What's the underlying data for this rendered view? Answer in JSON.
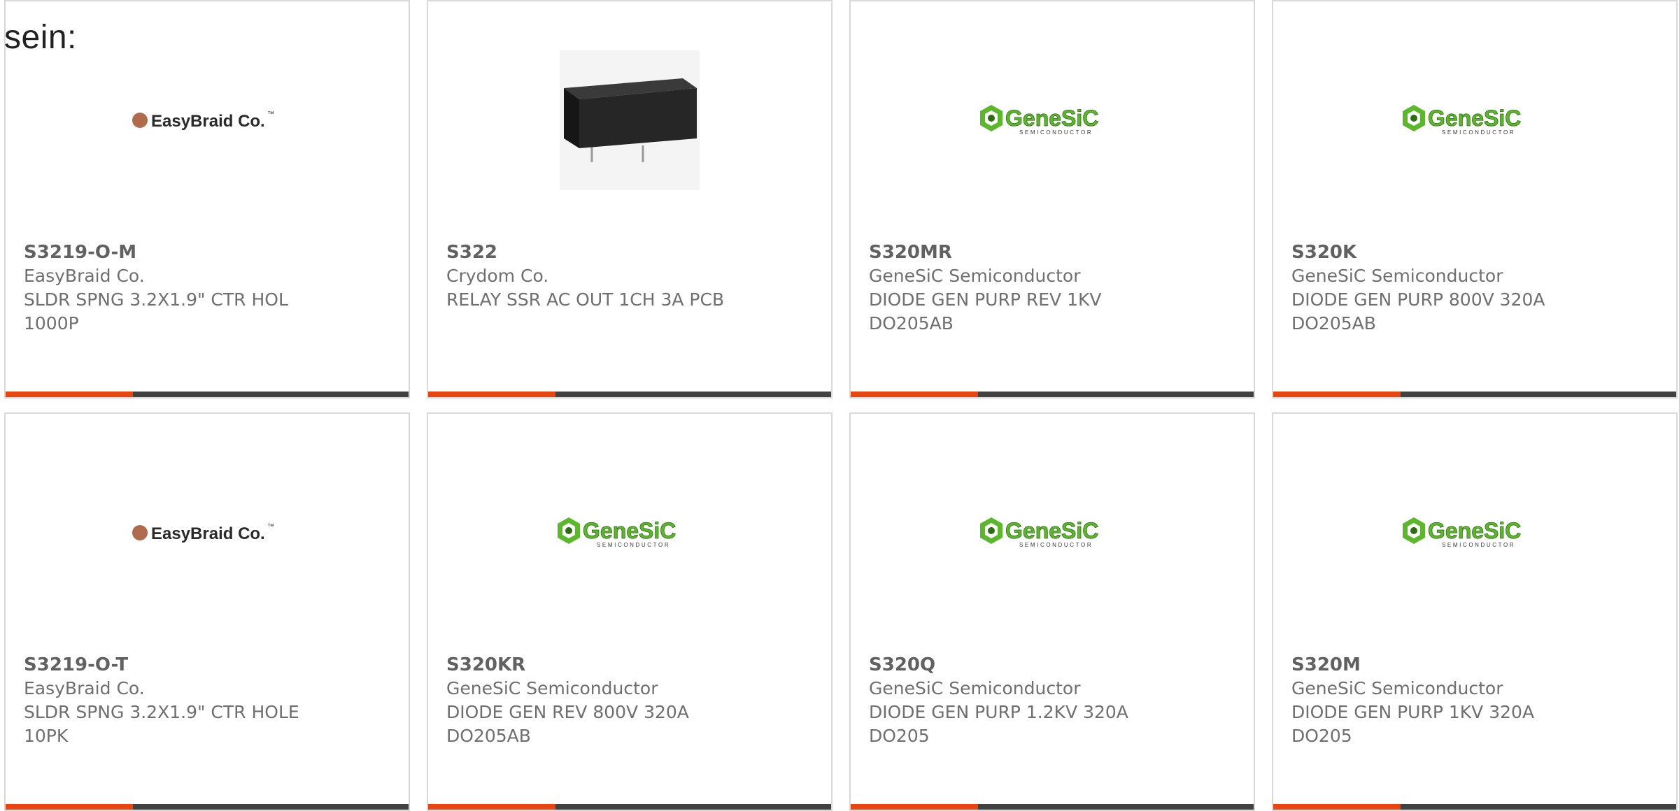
{
  "page": {
    "intro_text": "sein:"
  },
  "colors": {
    "accent": "#e84511",
    "footer": "#414141",
    "border": "#d9d9d9",
    "genesic_green": "#5ab82a",
    "easybraid_brown": "#b06a4c"
  },
  "products": [
    {
      "part_number": "S3219-O-M",
      "manufacturer": "EasyBraid Co.",
      "description": "SLDR SPNG 3.2X1.9\" CTR HOL 1000P",
      "image": {
        "type": "easybraid-logo",
        "text": "EasyBraid Co.",
        "mark": "™"
      }
    },
    {
      "part_number": "S322",
      "manufacturer": "Crydom Co.",
      "description": "RELAY SSR AC OUT 1CH 3A PCB",
      "image": {
        "type": "relay-photo"
      }
    },
    {
      "part_number": "S320MR",
      "manufacturer": "GeneSiC Semiconductor",
      "description": "DIODE GEN PURP REV 1KV DO205AB",
      "image": {
        "type": "genesic-logo",
        "text": "GeneSiC",
        "subtext": "SEMICONDUCTOR"
      }
    },
    {
      "part_number": "S320K",
      "manufacturer": "GeneSiC Semiconductor",
      "description": "DIODE GEN PURP 800V 320A DO205AB",
      "image": {
        "type": "genesic-logo",
        "text": "GeneSiC",
        "subtext": "SEMICONDUCTOR"
      }
    },
    {
      "part_number": "S3219-O-T",
      "manufacturer": "EasyBraid Co.",
      "description": "SLDR SPNG 3.2X1.9\" CTR HOLE 10PK",
      "image": {
        "type": "easybraid-logo",
        "text": "EasyBraid Co.",
        "mark": "™"
      }
    },
    {
      "part_number": "S320KR",
      "manufacturer": "GeneSiC Semiconductor",
      "description": "DIODE GEN REV 800V 320A DO205AB",
      "image": {
        "type": "genesic-logo",
        "text": "GeneSiC",
        "subtext": "SEMICONDUCTOR"
      }
    },
    {
      "part_number": "S320Q",
      "manufacturer": "GeneSiC Semiconductor",
      "description": "DIODE GEN PURP 1.2KV 320A DO205",
      "image": {
        "type": "genesic-logo",
        "text": "GeneSiC",
        "subtext": "SEMICONDUCTOR"
      }
    },
    {
      "part_number": "S320M",
      "manufacturer": "GeneSiC Semiconductor",
      "description": "DIODE GEN PURP 1KV 320A DO205",
      "image": {
        "type": "genesic-logo",
        "text": "GeneSiC",
        "subtext": "SEMICONDUCTOR"
      }
    }
  ]
}
